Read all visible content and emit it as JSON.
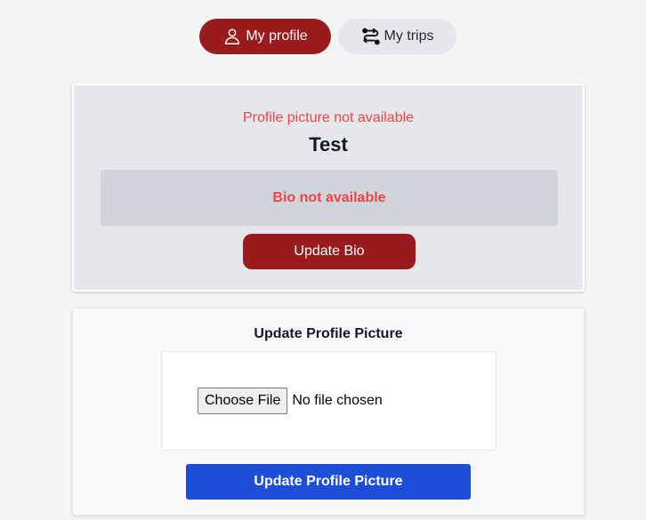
{
  "tabs": {
    "profile": {
      "label": "My profile",
      "icon": "user-icon",
      "active": true
    },
    "trips": {
      "label": "My trips",
      "icon": "route-icon",
      "active": false
    }
  },
  "profile_card": {
    "picture_status": "Profile picture not available",
    "username": "Test",
    "bio_status": "Bio not available",
    "update_bio_label": "Update Bio"
  },
  "upload_card": {
    "title": "Update Profile Picture",
    "choose_file_label": "Choose File",
    "file_status": "No file chosen",
    "submit_label": "Update Profile Picture"
  },
  "colors": {
    "brand_red": "#991b1b",
    "error_red": "#ef4444",
    "primary_blue": "#1d4ed8",
    "background": "#f3f4f6",
    "card_gray": "#e5e7eb",
    "bio_gray": "#d1d5db"
  }
}
